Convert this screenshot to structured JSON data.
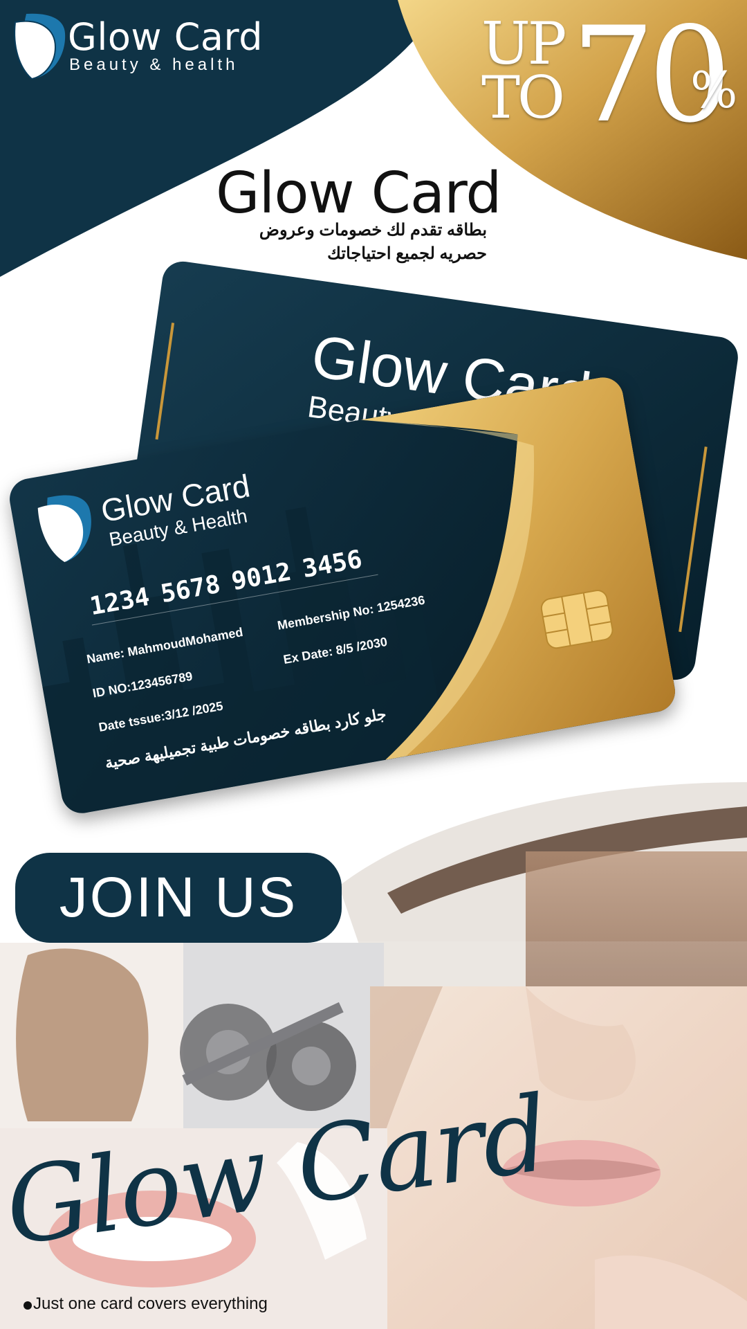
{
  "brand": {
    "name": "Glow Card",
    "tagline": "Beauty & health"
  },
  "promo": {
    "up": "UP",
    "to": "TO",
    "number": "70",
    "percent": "%"
  },
  "main_title": "Glow Card",
  "arabic_lines": [
    "بطاقه تقدم لك خصومات وعروض",
    "حصريه لجميع احتياجاتك"
  ],
  "back_card": {
    "title": "Glow Card",
    "subtitle": "Beauty & Health"
  },
  "front_card": {
    "brand": "Glow Card",
    "subtitle": "Beauty & Health",
    "numbers": [
      "1234",
      "5678",
      "9012",
      "3456"
    ],
    "name": "Name: MahmoudMohamed",
    "membership": "Membership No: 1254236",
    "id": "ID NO:123456789",
    "expiry": "Ex Date: 8/5 /2030",
    "issue": "Date tssue:3/12 /2025",
    "arabic_line1": "جلو كارد بطاقه خصومات طبية تجميليهة صحية"
  },
  "cta": {
    "label": "JOIN US"
  },
  "script_title": "Glow Card",
  "footer_text": "Just one card covers everything",
  "colors": {
    "navy": "#0f3346",
    "gold": "#c9973a",
    "gold_light": "#f0cf7c",
    "white": "#ffffff"
  }
}
